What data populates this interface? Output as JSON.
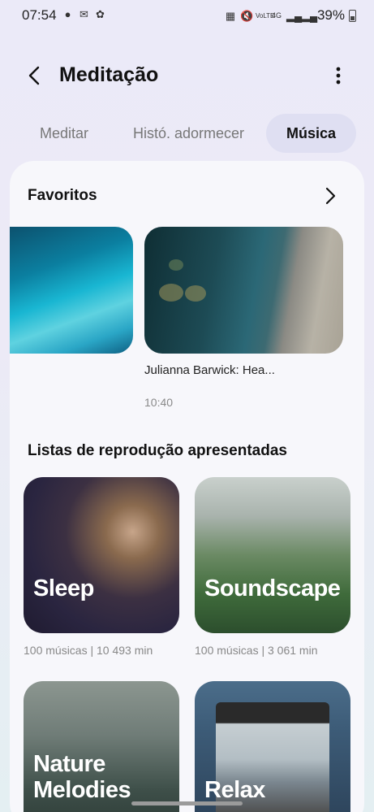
{
  "status": {
    "time": "07:54",
    "battery": "39%",
    "left_icons": [
      "bixby-icon",
      "sms-icon",
      "pinwheel-icon"
    ],
    "right_icons": [
      "nfc-icon",
      "mute-icon",
      "volte-icon",
      "4g-icon",
      "signal-icon",
      "signal-2-icon"
    ]
  },
  "header": {
    "title": "Meditação",
    "back_icon": "arrow-left-icon",
    "more_icon": "more-vertical-icon"
  },
  "tabs": [
    {
      "label": "Meditar",
      "selected": false
    },
    {
      "label": "Histó. adormecer",
      "selected": false
    },
    {
      "label": "Música",
      "selected": true
    }
  ],
  "favorites": {
    "title": "Favoritos",
    "items": [
      {
        "title": "",
        "duration": ""
      },
      {
        "title": "Julianna Barwick: Hea...",
        "duration": "10:40"
      }
    ]
  },
  "playlists": {
    "title": "Listas de reprodução apresentadas",
    "items": [
      {
        "name": "Sleep",
        "meta": "100 músicas | 10 493 min"
      },
      {
        "name": "Soundscape",
        "meta": "100 músicas | 3 061 min"
      },
      {
        "name": "Nature Melodies",
        "meta": ""
      },
      {
        "name": "Relax",
        "meta": ""
      }
    ]
  }
}
